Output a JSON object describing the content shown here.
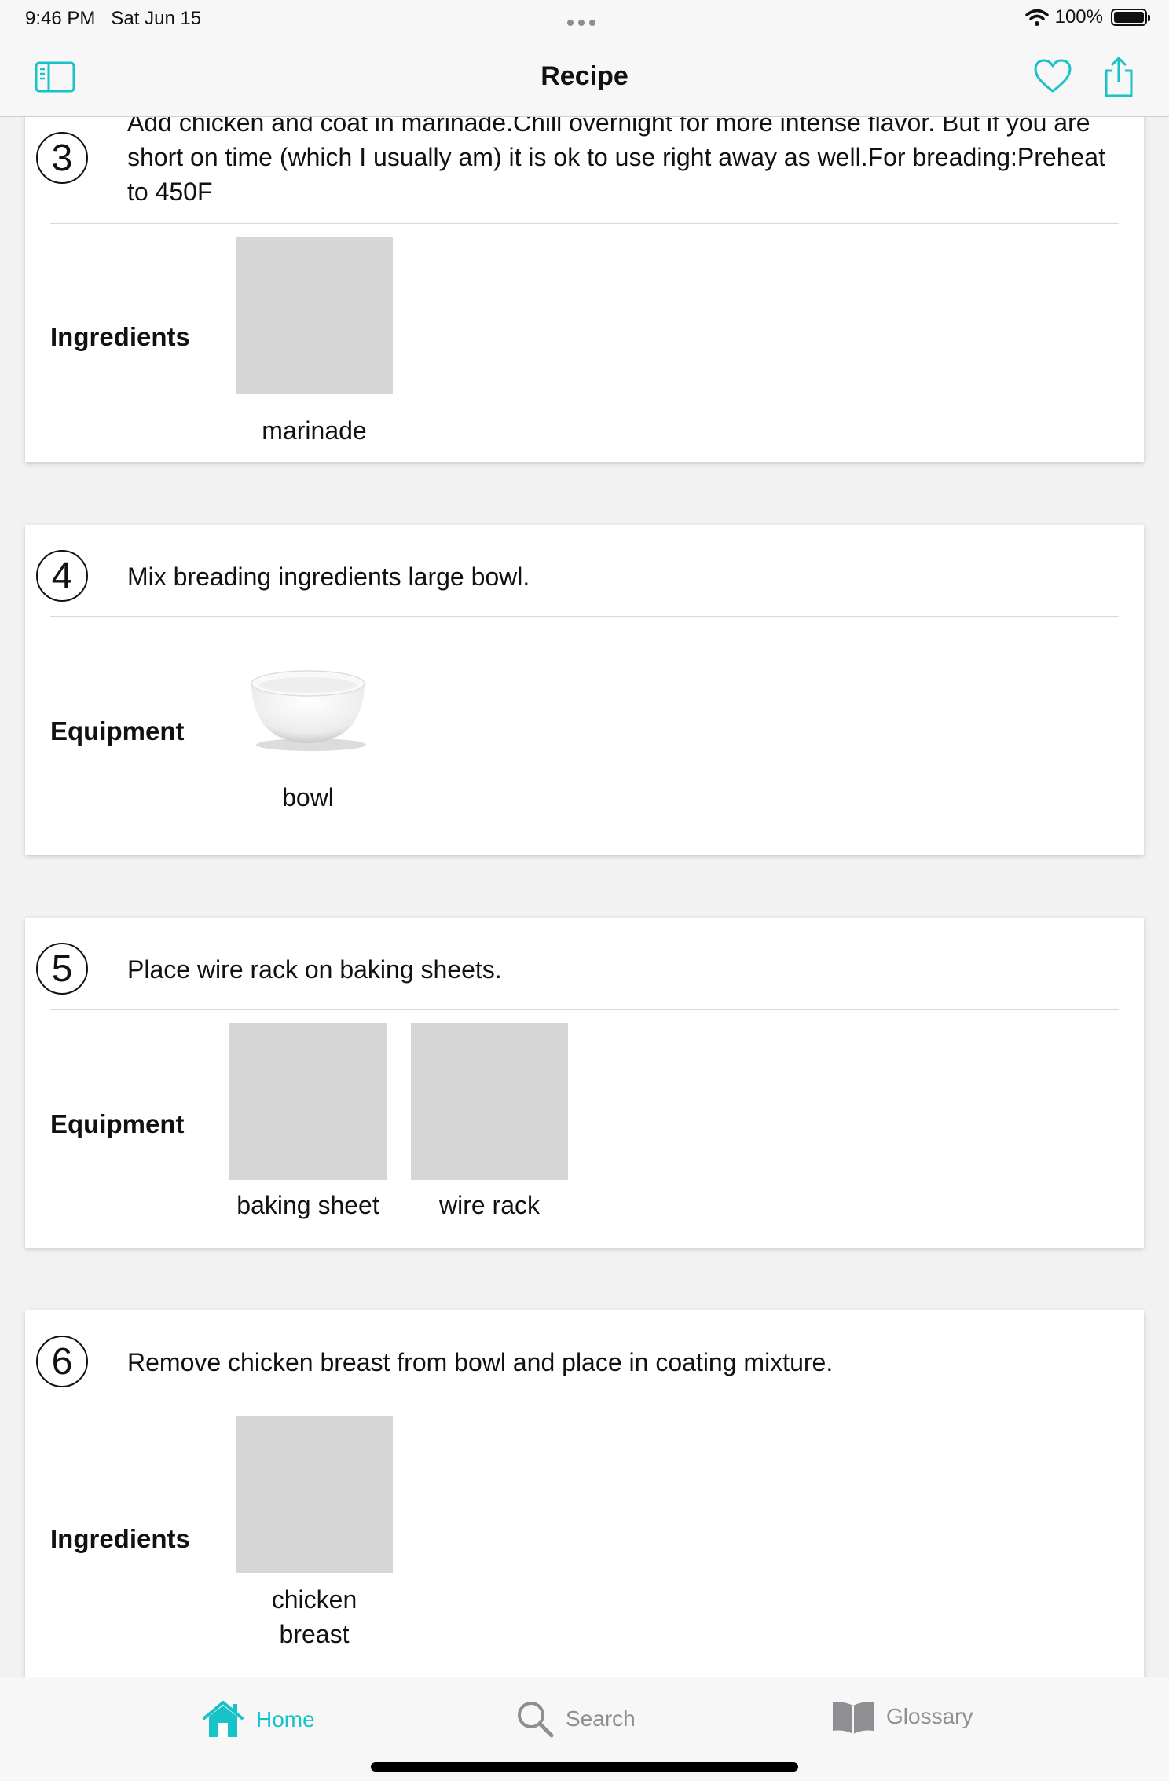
{
  "status_bar": {
    "time": "9:46 PM",
    "date": "Sat Jun 15",
    "battery": "100%"
  },
  "navbar": {
    "title": "Recipe"
  },
  "steps": [
    {
      "number": "3",
      "instruction": "Add chicken and coat in marinade.Chill overnight for more intense flavor. But if you are short on time (which I usually am) it is ok to use right away as well.For breading:Preheat to 450F",
      "section": "Ingredients",
      "items": [
        "marinade"
      ]
    },
    {
      "number": "4",
      "instruction": "Mix breading ingredients large bowl.",
      "section": "Equipment",
      "items": [
        "bowl"
      ]
    },
    {
      "number": "5",
      "instruction": "Place wire rack on baking sheets.",
      "section": "Equipment",
      "items": [
        "baking sheet",
        "wire rack"
      ]
    },
    {
      "number": "6",
      "instruction": "Remove chicken breast from bowl and place in coating mixture.",
      "section": "Ingredients",
      "items": [
        "chicken breast"
      ]
    }
  ],
  "tabs": [
    {
      "label": "Home",
      "icon": "home-icon",
      "active": true
    },
    {
      "label": "Search",
      "icon": "search-icon",
      "active": false
    },
    {
      "label": "Glossary",
      "icon": "book-icon",
      "active": false
    }
  ],
  "colors": {
    "accent": "#17c2c8",
    "placeholder": "#d6d6d6"
  }
}
